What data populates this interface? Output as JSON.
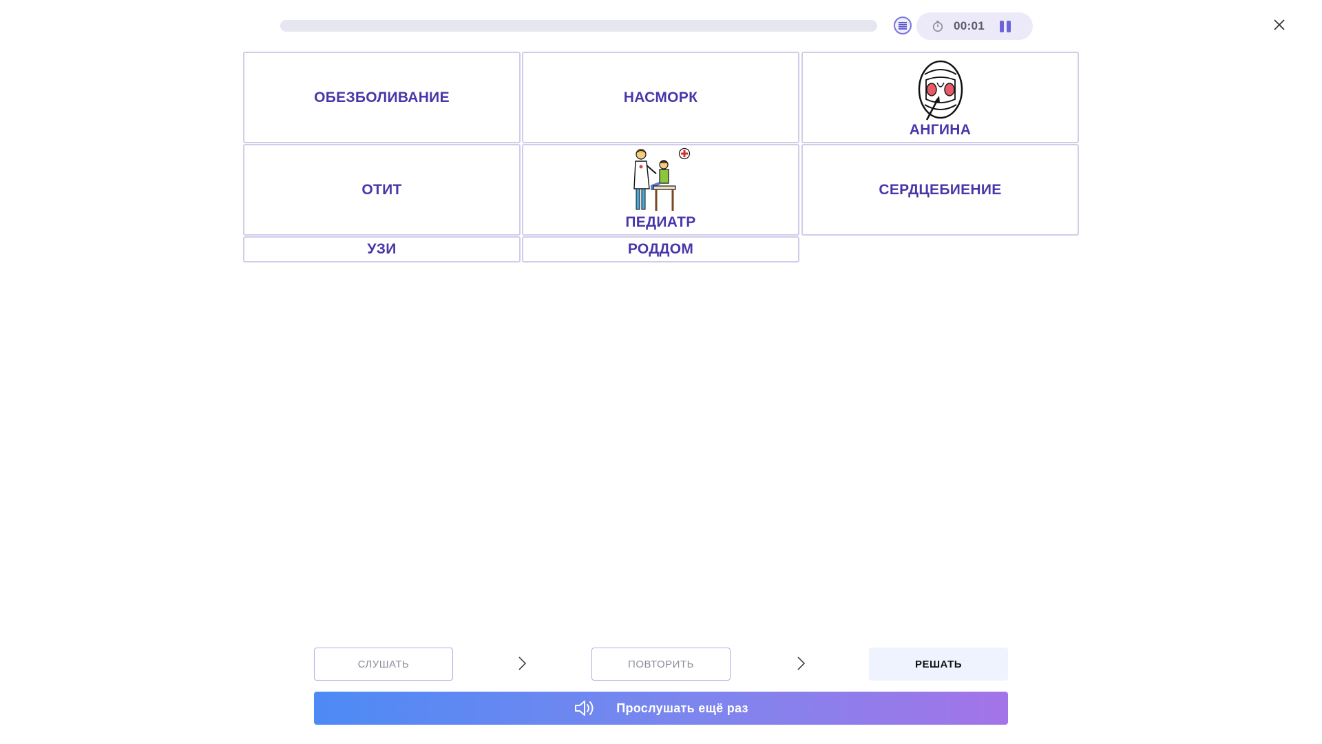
{
  "header": {
    "progress": 0.0,
    "timer": "00:01",
    "icons": {
      "list": "list-icon",
      "stopwatch": "stopwatch-icon",
      "pause": "pause-icon",
      "close": "close-icon"
    }
  },
  "tiles": [
    {
      "label": "ОБЕЗБОЛИВАНИЕ"
    },
    {
      "label": "НАСМОРК"
    },
    {
      "label": "АНГИНА",
      "icon": "open-mouth-throat-icon"
    },
    {
      "label": "ОТИТ"
    },
    {
      "label": "ПЕДИАТР",
      "icon": "doctor-examining-child-icon"
    },
    {
      "label": "СЕРДЦЕБИЕНИЕ"
    },
    {
      "label": "УЗИ"
    },
    {
      "label": "РОДДОМ"
    }
  ],
  "footer": {
    "steps": [
      {
        "label": "СЛУШАТЬ",
        "active": false
      },
      {
        "label": "ПОВТОРИТЬ",
        "active": false
      },
      {
        "label": "РЕШАТЬ",
        "active": true
      }
    ],
    "listen_again_label": "Прослушать ещё раз",
    "listen_icon": "speaker-icon"
  },
  "colors": {
    "accent": "#4936a8",
    "tile_border": "#cfcde9",
    "gradient_start": "#4d8af5",
    "gradient_end": "#a374e8"
  }
}
